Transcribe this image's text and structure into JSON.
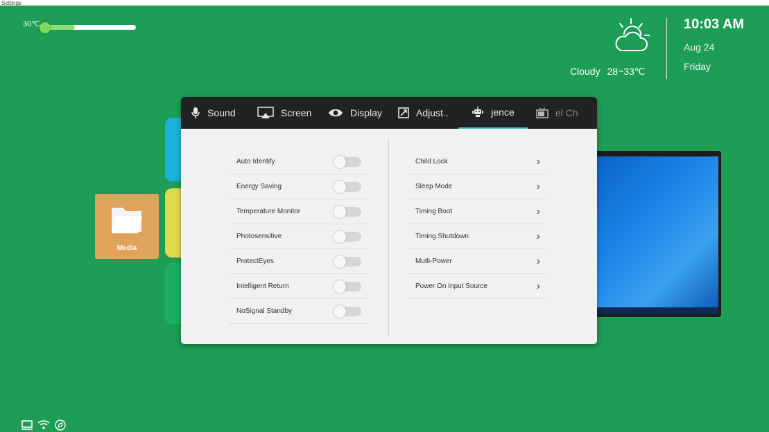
{
  "top_label": "Settings",
  "temperature": {
    "label": "30℃",
    "level": 0.35
  },
  "weather": {
    "icon": "cloudy-sun-icon",
    "condition": "Cloudy",
    "range": "28~33℃"
  },
  "clock": {
    "time": "10:03 AM",
    "date": "Aug 24",
    "day": "Friday"
  },
  "background": {
    "media_tile_label": "Media"
  },
  "tabs": [
    {
      "label": "Sound",
      "icon": "microphone-icon"
    },
    {
      "label": "Screen",
      "icon": "screen-cast-icon"
    },
    {
      "label": "Display",
      "icon": "eye-icon"
    },
    {
      "label": "Adjust..",
      "icon": "adjust-icon"
    },
    {
      "label": "jence",
      "icon": "robot-icon",
      "active": true
    },
    {
      "label": "el  Ch",
      "icon": "tv-icon"
    }
  ],
  "left_settings": [
    {
      "label": "Auto Identify",
      "on": false
    },
    {
      "label": "Energy Saving",
      "on": false
    },
    {
      "label": "Temperature Monitor",
      "on": false
    },
    {
      "label": "Photosensitive",
      "on": false
    },
    {
      "label": "ProtectEyes",
      "on": false
    },
    {
      "label": "Intelligent Return",
      "on": false
    },
    {
      "label": "NoSignal Standby",
      "on": false
    }
  ],
  "right_settings": [
    {
      "label": "Child Lock"
    },
    {
      "label": "Sleep Mode"
    },
    {
      "label": "Timing Boot"
    },
    {
      "label": "Timing Shutdown"
    },
    {
      "label": "Mutli-Power"
    },
    {
      "label": "Power On Input Source"
    }
  ],
  "status_icons": [
    "usb-icon",
    "wifi-icon",
    "eco-icon"
  ],
  "colors": {
    "background": "#1d9d55",
    "tab_bar": "#222222",
    "tab_active_underline": "#43c0c8"
  }
}
